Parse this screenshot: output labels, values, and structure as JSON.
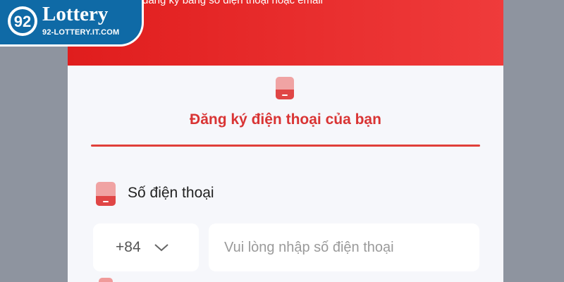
{
  "logo": {
    "name": "Lottery",
    "domain": "92-LOTTERY.IT.COM"
  },
  "header": {
    "subtitle": "đăng ký bằng số điện thoại hoặc email"
  },
  "tab": {
    "icon": "phone-icon",
    "title": "Đăng ký điện thoại của bạn"
  },
  "field": {
    "icon": "phone-icon",
    "label": "Số điện thoại",
    "country_code": "+84",
    "placeholder": "Vui lòng nhập số điện thoại",
    "value": ""
  },
  "colors": {
    "accent": "#e01d1d",
    "title": "#d93434",
    "background": "#8e949f",
    "logo_blue": "#0f6aa6"
  }
}
